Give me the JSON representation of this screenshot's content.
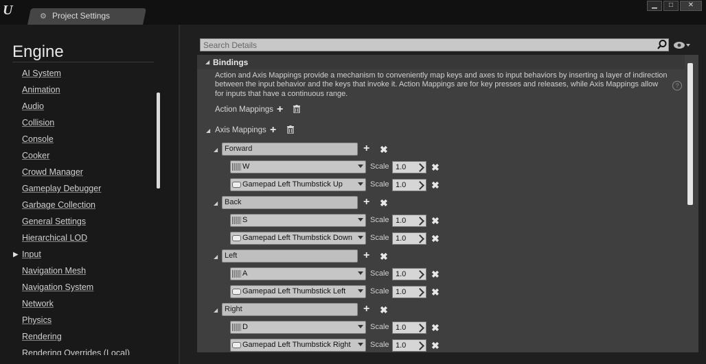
{
  "window": {
    "tab_title": "Project Settings",
    "controls": [
      "minimize-icon",
      "maximize-icon",
      "close-icon"
    ]
  },
  "sidebar": {
    "title": "Engine",
    "selected": "Input",
    "items": [
      {
        "label": "AI System"
      },
      {
        "label": "Animation"
      },
      {
        "label": "Audio"
      },
      {
        "label": "Collision"
      },
      {
        "label": "Console"
      },
      {
        "label": "Cooker"
      },
      {
        "label": "Crowd Manager"
      },
      {
        "label": "Gameplay Debugger"
      },
      {
        "label": "Garbage Collection"
      },
      {
        "label": "General Settings"
      },
      {
        "label": "Hierarchical LOD"
      },
      {
        "label": "Input"
      },
      {
        "label": "Navigation Mesh"
      },
      {
        "label": "Navigation System"
      },
      {
        "label": "Network"
      },
      {
        "label": "Physics"
      },
      {
        "label": "Rendering"
      },
      {
        "label": "Rendering Overrides (Local)"
      }
    ]
  },
  "search": {
    "placeholder": "Search Details"
  },
  "bindings": {
    "header": "Bindings",
    "description": "Action and Axis Mappings provide a mechanism to conveniently map keys and axes to input behaviors by inserting a layer of indirection between the input behavior and the keys that invoke it. Action Mappings are for key presses and releases, while Axis Mappings allow for inputs that have a continuous range.",
    "action_mappings_label": "Action Mappings",
    "axis_mappings_label": "Axis Mappings",
    "scale_label": "Scale",
    "axes": [
      {
        "name": "Forward",
        "keys": [
          {
            "key": "W",
            "type": "keyboard",
            "scale": "1.0"
          },
          {
            "key": "Gamepad Left Thumbstick Up",
            "type": "gamepad",
            "scale": "1.0"
          }
        ]
      },
      {
        "name": "Back",
        "keys": [
          {
            "key": "S",
            "type": "keyboard",
            "scale": "1.0"
          },
          {
            "key": "Gamepad Left Thumbstick Down",
            "type": "gamepad",
            "scale": "1.0"
          }
        ]
      },
      {
        "name": "Left",
        "keys": [
          {
            "key": "A",
            "type": "keyboard",
            "scale": "1.0"
          },
          {
            "key": "Gamepad Left Thumbstick Left",
            "type": "gamepad",
            "scale": "1.0"
          }
        ]
      },
      {
        "name": "Right",
        "keys": [
          {
            "key": "D",
            "type": "keyboard",
            "scale": "1.0"
          },
          {
            "key": "Gamepad Left Thumbstick Right",
            "type": "gamepad",
            "scale": "1.0"
          }
        ]
      }
    ]
  }
}
